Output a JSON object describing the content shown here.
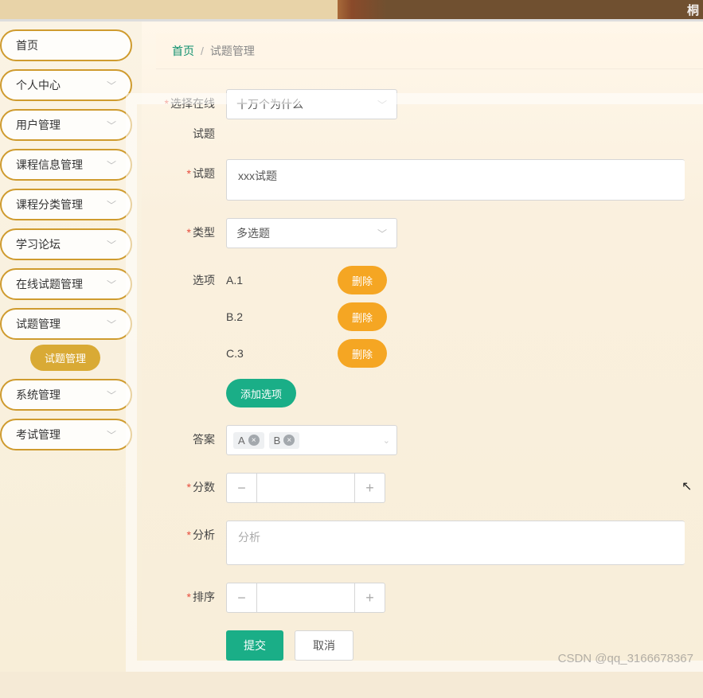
{
  "banner": {
    "text": "桐"
  },
  "sidebar": {
    "items": [
      {
        "label": "首页",
        "expandable": false
      },
      {
        "label": "个人中心",
        "expandable": true
      },
      {
        "label": "用户管理",
        "expandable": true
      },
      {
        "label": "课程信息管理",
        "expandable": true
      },
      {
        "label": "课程分类管理",
        "expandable": true
      },
      {
        "label": "学习论坛",
        "expandable": true
      },
      {
        "label": "在线试题管理",
        "expandable": true
      },
      {
        "label": "试题管理",
        "expandable": true
      },
      {
        "label": "系统管理",
        "expandable": true
      },
      {
        "label": "考试管理",
        "expandable": true
      }
    ],
    "subItem": "试题管理"
  },
  "breadcrumb": {
    "home": "首页",
    "sep": "/",
    "current": "试题管理"
  },
  "form": {
    "labels": {
      "selectOnline1": "选择在线",
      "selectOnline2": "试题",
      "question": "试题",
      "type": "类型",
      "options": "选项",
      "answer": "答案",
      "score": "分数",
      "analysis": "分析",
      "sort": "排序"
    },
    "values": {
      "selectOnline": "十万个为什么",
      "question": "xxx试题",
      "type": "多选题",
      "options": [
        {
          "text": "A.1",
          "del": "删除"
        },
        {
          "text": "B.2",
          "del": "删除"
        },
        {
          "text": "C.3",
          "del": "删除"
        }
      ],
      "addOption": "添加选项",
      "answerTags": [
        "A",
        "B"
      ],
      "score": "",
      "analysisPlaceholder": "分析",
      "sort": ""
    },
    "actions": {
      "submit": "提交",
      "cancel": "取消"
    }
  },
  "watermark": "CSDN @qq_3166678367"
}
